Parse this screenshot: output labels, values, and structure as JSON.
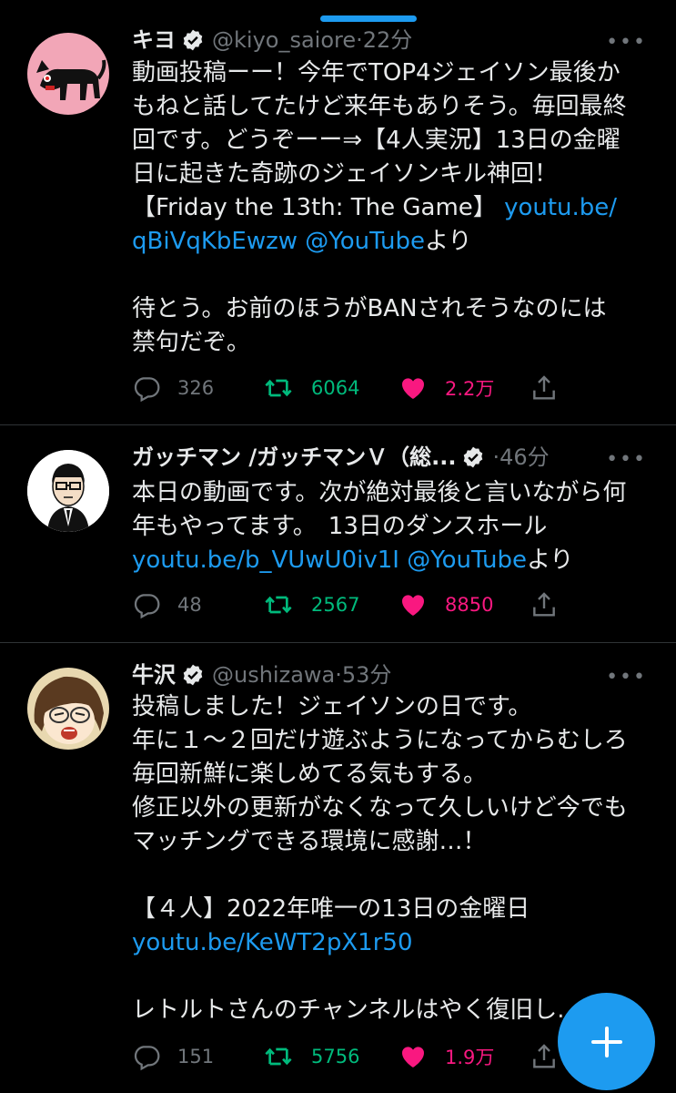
{
  "tweets": [
    {
      "name": "キヨ",
      "handle": "@kiyo_saiore",
      "dot": "·",
      "time": "22分",
      "lines": [
        {
          "text": "動画投稿ーー！今年でTOP4ジェイソン最後か"
        },
        {
          "text": "もねと話してたけど来年もありそう。毎回最終"
        },
        {
          "text": "回です。どうぞーー⇒【4人実況】13日の金曜"
        },
        {
          "text": "日に起きた奇跡のジェイソンキル神回！"
        },
        {
          "text": "【Friday the 13th: The Game】 ",
          "link": "youtu.be/"
        },
        {
          "link": "qBiVqKbEwzw @YouTube",
          "text2": "より"
        },
        {
          "blank": true
        },
        {
          "text": "待とう。お前のほうがBANされそうなのには"
        },
        {
          "text": "禁句だぞ。"
        }
      ],
      "replies": "326",
      "retweets": "6064",
      "likes": "2.2万"
    },
    {
      "name": "ガッチマン /ガッチマンＶ（総...",
      "handle": "",
      "dot": "·",
      "time": "46分",
      "lines": [
        {
          "text": "本日の動画です。次が絶対最後と言いながら何"
        },
        {
          "text": "年もやってます。　13日のダンスホール"
        },
        {
          "link": "youtu.be/b_VUwU0iv1I @YouTube",
          "text2": "より"
        }
      ],
      "replies": "48",
      "retweets": "2567",
      "likes": "8850"
    },
    {
      "name": "牛沢",
      "handle": "@ushizawa",
      "dot": "·",
      "time": "53分",
      "lines": [
        {
          "text": "投稿しました！ジェイソンの日です。"
        },
        {
          "text": "年に１〜２回だけ遊ぶようになってからむしろ"
        },
        {
          "text": "毎回新鮮に楽しめてる気もする。"
        },
        {
          "text": "修正以外の更新がなくなって久しいけど今でも"
        },
        {
          "text": "マッチングできる環境に感謝…！"
        },
        {
          "blank": true
        },
        {
          "text": "【４人】2022年唯一の13日の金曜日"
        },
        {
          "link": "youtu.be/KeWT2pX1r50"
        },
        {
          "blank": true
        },
        {
          "text": "レトルトさんのチャンネルはやく復旧し..."
        }
      ],
      "replies": "151",
      "retweets": "5756",
      "likes": "1.9万"
    }
  ],
  "icons": {
    "reply": "comment-icon",
    "retweet": "retweet-icon",
    "like": "heart-icon",
    "share": "share-icon",
    "more": "more-icon",
    "verified": "verified-badge-icon",
    "compose": "compose-plus-icon"
  },
  "colors": {
    "accent": "#1d9bf0",
    "retweet": "#00ba7c",
    "like": "#f91880",
    "muted": "#71767b",
    "background": "#000000"
  }
}
